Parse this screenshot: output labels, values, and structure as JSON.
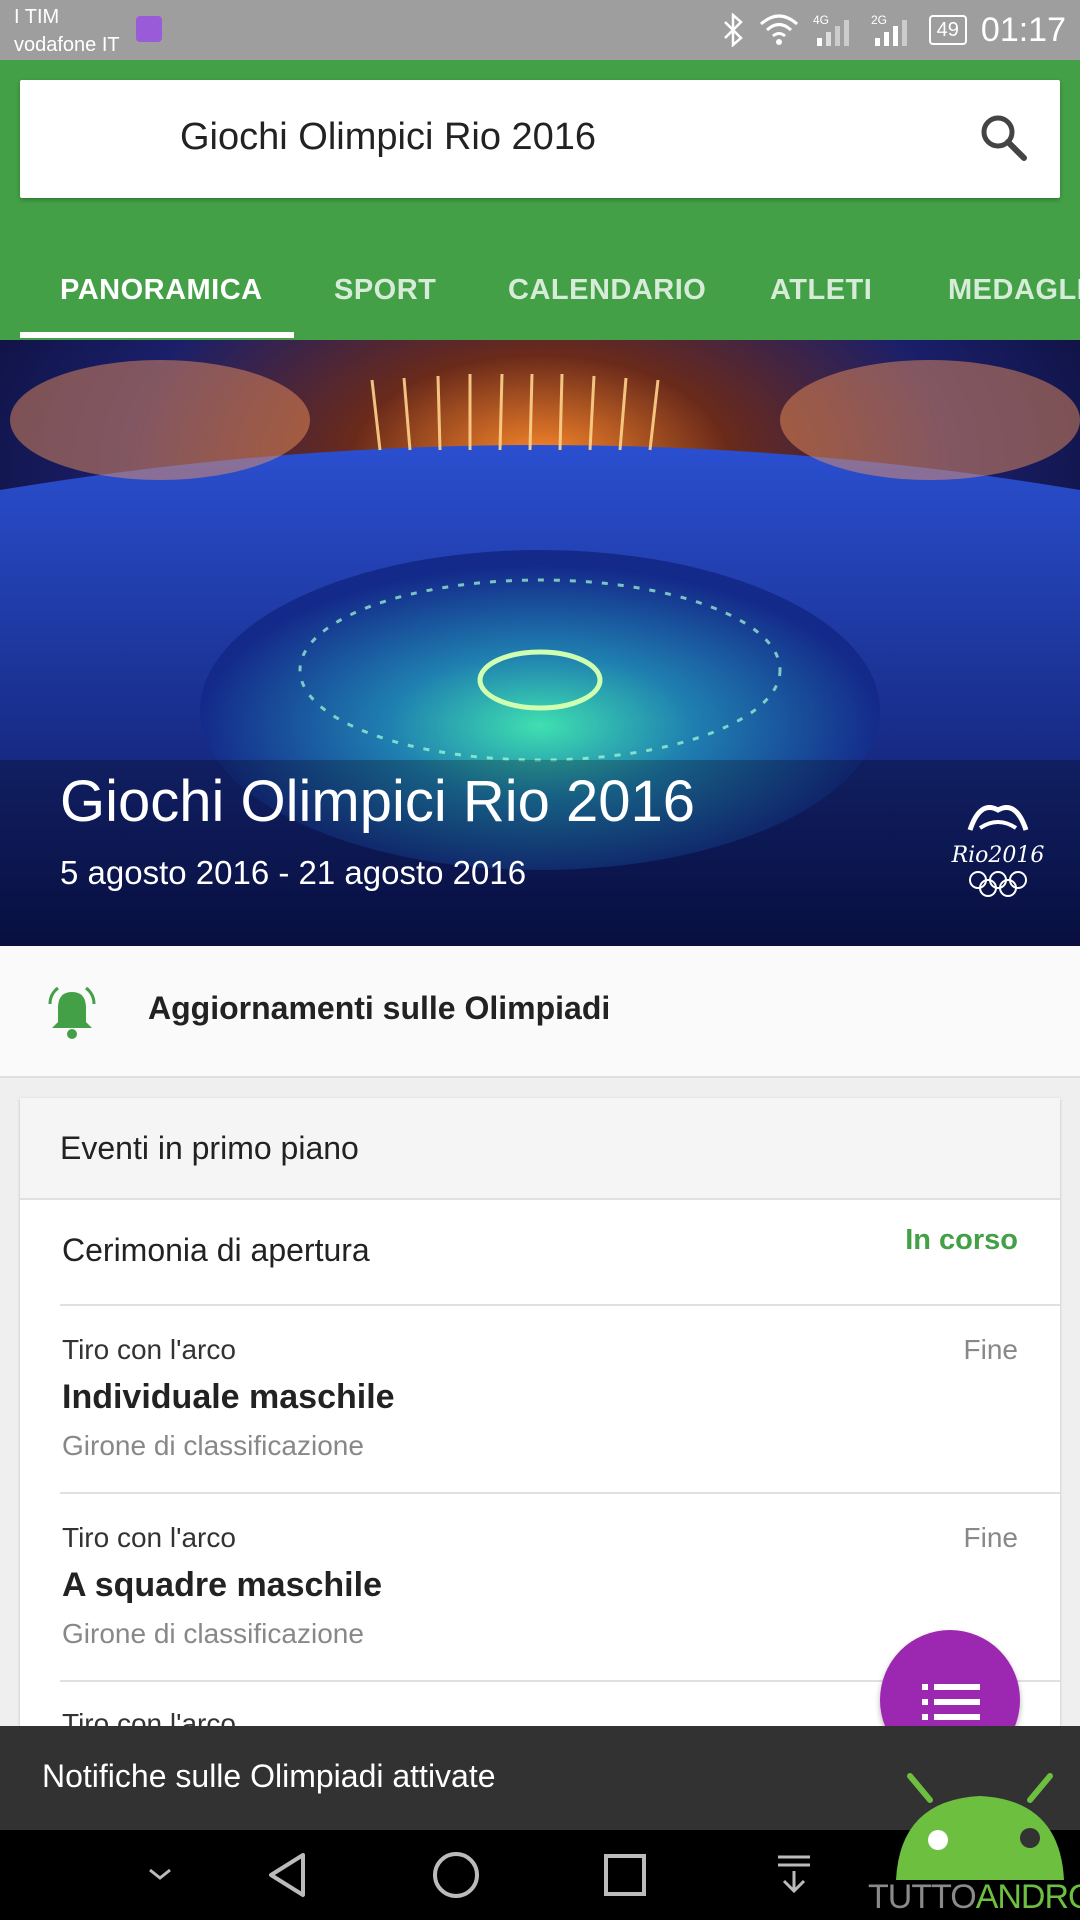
{
  "status_bar": {
    "carrier1": "I TIM",
    "carrier2": "vodafone IT",
    "net1": "4G",
    "net2": "2G",
    "battery": "49",
    "time": "01:17"
  },
  "search": {
    "query": "Giochi Olimpici Rio 2016"
  },
  "tabs": [
    {
      "label": "PANORAMICA",
      "active": true
    },
    {
      "label": "SPORT"
    },
    {
      "label": "CALENDARIO"
    },
    {
      "label": "ATLETI"
    },
    {
      "label": "MEDAGLI"
    }
  ],
  "hero": {
    "title": "Giochi Olimpici Rio 2016",
    "dates": "5 agosto 2016 - 21 agosto 2016",
    "logo_text": "Rio2016"
  },
  "notifications": {
    "label": "Aggiornamenti sulle Olimpiadi"
  },
  "events_card": {
    "header": "Eventi in primo piano",
    "featured": {
      "name": "Cerimonia di apertura",
      "status": "In corso"
    },
    "items": [
      {
        "sport": "Tiro con l'arco",
        "title": "Individuale maschile",
        "phase": "Girone di classificazione",
        "status": "Fine"
      },
      {
        "sport": "Tiro con l'arco",
        "title": "A squadre maschile",
        "phase": "Girone di classificazione",
        "status": "Fine"
      },
      {
        "sport": "Tiro con l'arco"
      }
    ]
  },
  "snackbar": {
    "message": "Notifiche sulle Olimpiadi attivate"
  },
  "watermark": {
    "part1": "TUTTO",
    "part2": "ANDROID"
  },
  "colors": {
    "header_green": "#43a047",
    "status_green": "#43a047",
    "fab_purple": "#9c27b0"
  }
}
